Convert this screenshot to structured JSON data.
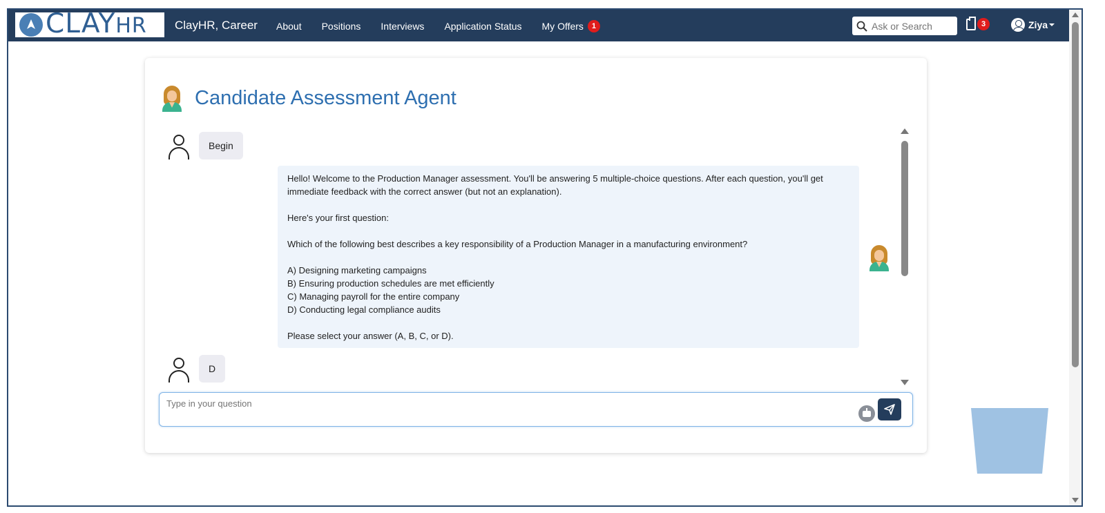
{
  "nav": {
    "logo_main": "CLAY",
    "logo_sub": "HR",
    "brand_title": "ClayHR, Career",
    "links": [
      {
        "label": "About"
      },
      {
        "label": "Positions"
      },
      {
        "label": "Interviews"
      },
      {
        "label": "Application Status"
      },
      {
        "label": "My Offers",
        "badge": "1"
      }
    ],
    "search_placeholder": "Ask or Search",
    "clipboard_badge": "3",
    "user_name": "Ziya"
  },
  "card": {
    "title": "Candidate Assessment Agent"
  },
  "chat": {
    "messages": [
      {
        "role": "user",
        "text": "Begin"
      },
      {
        "role": "agent",
        "lines": [
          "Hello! Welcome to the Production Manager assessment. You'll be answering 5 multiple-choice questions. After each question, you'll get immediate feedback with the correct answer (but not an explanation).",
          "Here's your first question:",
          "Which of the following best describes a key responsibility of a Production Manager in a manufacturing environment?",
          "A) Designing marketing campaigns",
          "B) Ensuring production schedules are met efficiently",
          "C) Managing payroll for the entire company",
          "D) Conducting legal compliance audits",
          "Please select your answer (A, B, C, or D)."
        ]
      },
      {
        "role": "user",
        "text": "D"
      }
    ],
    "input_placeholder": "Type in your question"
  },
  "colors": {
    "nav_bg": "#243d5c",
    "title": "#2e6fb0",
    "badge": "#e01c1c",
    "agent_bubble": "#eef4fb",
    "user_bubble": "#ececf2"
  }
}
